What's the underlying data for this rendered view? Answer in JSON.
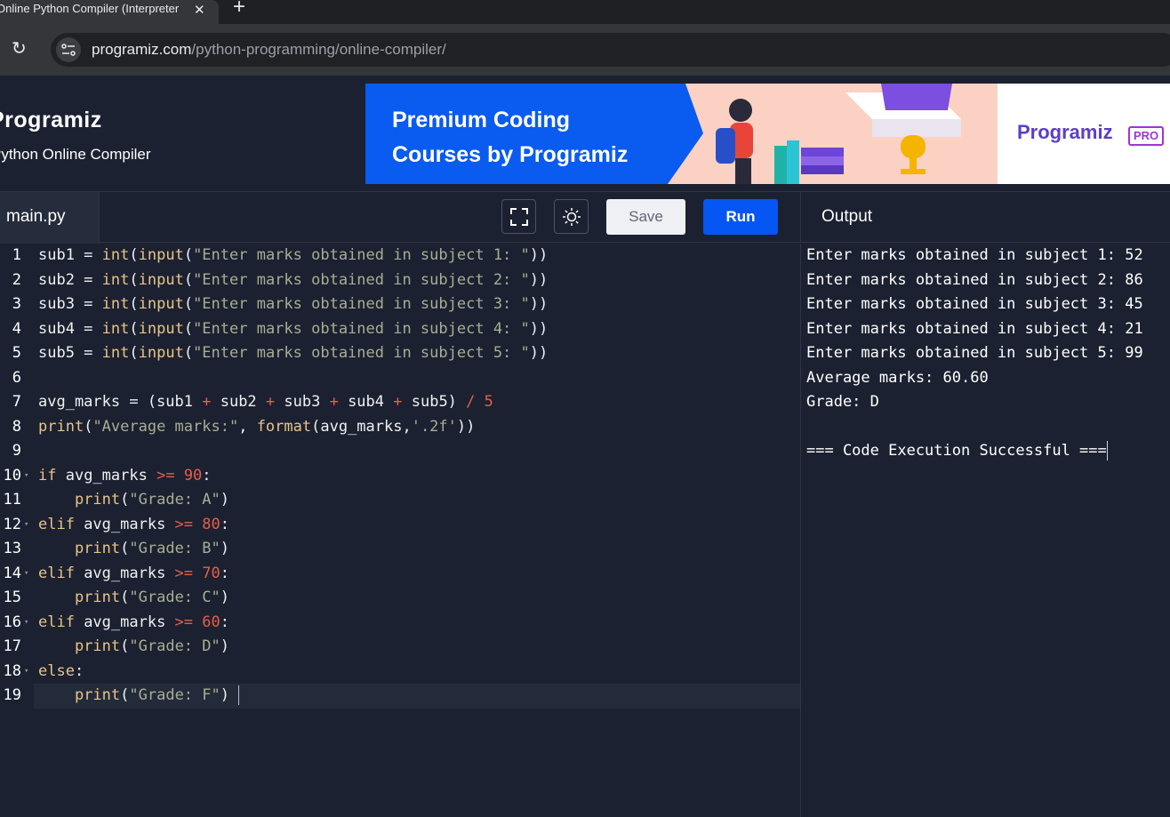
{
  "browser": {
    "tab_title": "Online Python Compiler (Interpreter)",
    "url_host": "programiz.com",
    "url_path": "/python-programming/online-compiler/"
  },
  "site": {
    "brand": "Programiz",
    "subtitle": "Python Online Compiler"
  },
  "banner": {
    "line1": "Premium Coding",
    "line2": "Courses by Programiz",
    "logo": "Programiz",
    "badge": "PRO"
  },
  "editor": {
    "file_name": "main.py",
    "save_label": "Save",
    "run_label": "Run",
    "fullscreen_icon": "fullscreen-icon",
    "theme_icon": "sun-icon",
    "lines": [
      "sub1 = int(input(\"Enter marks obtained in subject 1: \"))",
      "sub2 = int(input(\"Enter marks obtained in subject 2: \"))",
      "sub3 = int(input(\"Enter marks obtained in subject 3: \"))",
      "sub4 = int(input(\"Enter marks obtained in subject 4: \"))",
      "sub5 = int(input(\"Enter marks obtained in subject 5: \"))",
      "",
      "avg_marks = (sub1 + sub2 + sub3 + sub4 + sub5) / 5",
      "print(\"Average marks:\", format(avg_marks,'.2f'))",
      "",
      "if avg_marks >= 90:",
      "    print(\"Grade: A\")",
      "elif avg_marks >= 80:",
      "    print(\"Grade: B\")",
      "elif avg_marks >= 70:",
      "    print(\"Grade: C\")",
      "elif avg_marks >= 60:",
      "    print(\"Grade: D\")",
      "else:",
      "    print(\"Grade: F\")"
    ],
    "line_numbers": [
      "1",
      "2",
      "3",
      "4",
      "5",
      "6",
      "7",
      "8",
      "9",
      "10",
      "11",
      "12",
      "13",
      "14",
      "15",
      "16",
      "17",
      "18",
      "19"
    ]
  },
  "output": {
    "label": "Output",
    "lines": [
      "Enter marks obtained in subject 1: 52",
      "Enter marks obtained in subject 2: 86",
      "Enter marks obtained in subject 3: 45",
      "Enter marks obtained in subject 4: 21",
      "Enter marks obtained in subject 5: 99",
      "Average marks: 60.60",
      "Grade: D",
      "",
      "=== Code Execution Successful ==="
    ]
  },
  "colors": {
    "background": "#1b2130",
    "run_button": "#0556f3",
    "banner": "#0a5bf0",
    "keyword": "#e9c38a",
    "string": "#a9ad93",
    "number": "#e85d4a"
  }
}
